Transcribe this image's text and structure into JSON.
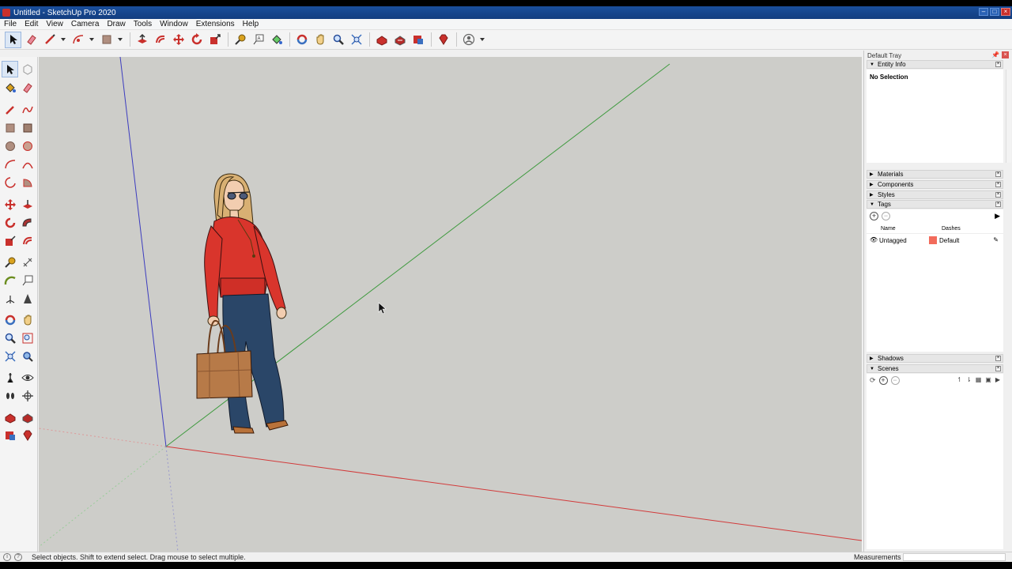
{
  "window": {
    "title": "Untitled - SketchUp Pro 2020"
  },
  "menu": [
    "File",
    "Edit",
    "View",
    "Camera",
    "Draw",
    "Tools",
    "Window",
    "Extensions",
    "Help"
  ],
  "tray": {
    "title": "Default Tray",
    "entity_info": {
      "label": "Entity Info",
      "content": "No Selection"
    },
    "materials": {
      "label": "Materials"
    },
    "components": {
      "label": "Components"
    },
    "styles": {
      "label": "Styles"
    },
    "tags": {
      "label": "Tags",
      "col_name": "Name",
      "col_dashes": "Dashes",
      "rows": [
        {
          "name": "Untagged",
          "dashes": "Default",
          "color": "#f26b5b"
        }
      ]
    },
    "shadows": {
      "label": "Shadows"
    },
    "scenes": {
      "label": "Scenes"
    }
  },
  "status": {
    "hint": "Select objects. Shift to extend select. Drag mouse to select multiple.",
    "measurements_label": "Measurements",
    "measurements_value": ""
  },
  "colors": {
    "axis_red": "#d23a3a",
    "axis_green": "#3f9a3f",
    "axis_blue": "#3c3cbf",
    "viewport_bg": "#cdcdc9",
    "accent_red": "#c9302c"
  }
}
